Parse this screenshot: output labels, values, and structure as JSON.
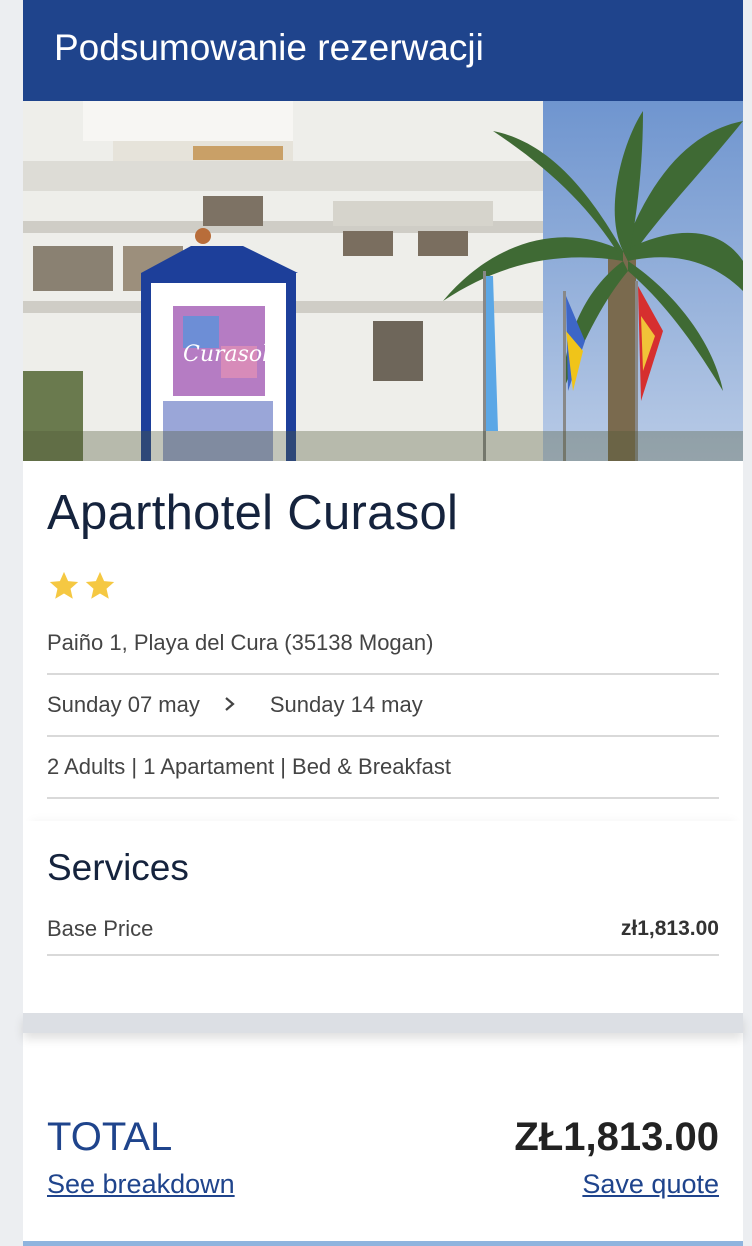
{
  "header": {
    "title": "Podsumowanie rezerwacji"
  },
  "photo": {
    "icon": "hotel-photo"
  },
  "hotel": {
    "name": "Aparthotel Curasol",
    "rating": 2,
    "star_color": "#f5c842",
    "address": "Paiño 1, Playa del Cura (35138 Mogan)",
    "checkin": "Sunday 07 may",
    "checkout": "Sunday 14 may",
    "occupancy": "2 Adults | 1 Apartament | Bed & Breakfast"
  },
  "services": {
    "title": "Services",
    "items": [
      {
        "label": "Base Price",
        "price": "zł1,813.00"
      }
    ]
  },
  "total": {
    "label": "TOTAL",
    "price": "ZŁ1,813.00",
    "breakdown_link": "See breakdown",
    "save_link": "Save quote"
  },
  "colors": {
    "brand": "#1f448c",
    "accent_bar": "#8fb4de"
  }
}
